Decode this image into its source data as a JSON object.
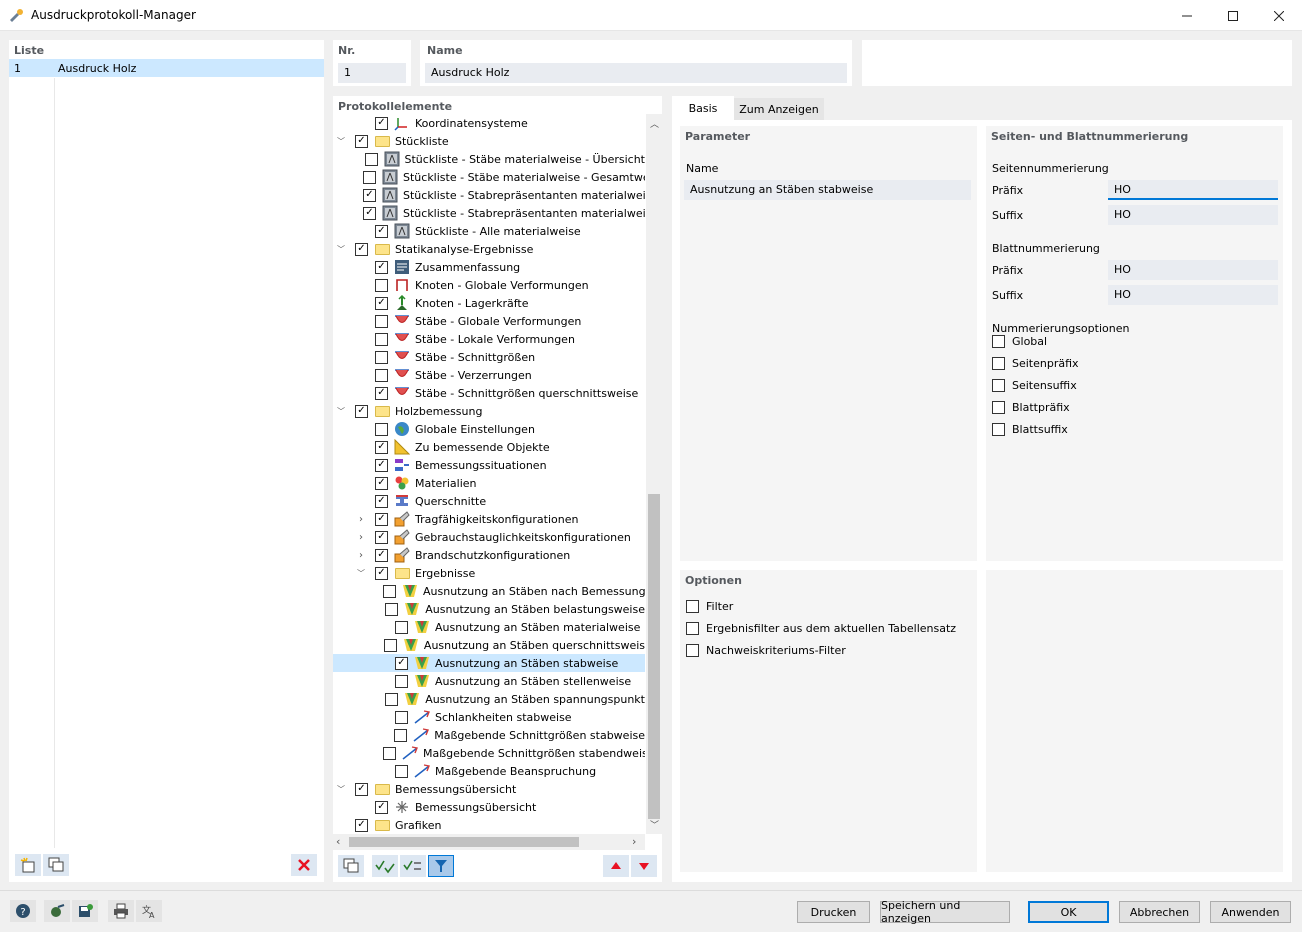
{
  "window": {
    "title": "Ausdruckprotokoll-Manager",
    "minimize": "–",
    "maximize": "☐",
    "close": "✕"
  },
  "list": {
    "header": "Liste",
    "items": [
      {
        "number": "1",
        "name": "Ausdruck Holz"
      }
    ]
  },
  "nr": {
    "header": "Nr.",
    "value": "1"
  },
  "name": {
    "header": "Name",
    "value": "Ausdruck Holz"
  },
  "tree": {
    "header": "Protokollelemente",
    "rows": [
      {
        "label": "Koordinatensysteme",
        "level": 1,
        "checked": true,
        "icon": "axes-icon"
      },
      {
        "label": "Stückliste",
        "level": 0,
        "checked": true,
        "icon": "folder-icon",
        "expand": "⌄"
      },
      {
        "label": "Stückliste - Stäbe materialweise - Übersicht",
        "level": 1,
        "checked": false,
        "icon": "table-icon"
      },
      {
        "label": "Stückliste - Stäbe materialweise - Gesamtwert",
        "level": 1,
        "checked": false,
        "icon": "table-icon"
      },
      {
        "label": "Stückliste - Stabrepräsentanten materialweis",
        "level": 1,
        "checked": true,
        "icon": "table-icon"
      },
      {
        "label": "Stückliste - Stabrepräsentanten materialweis",
        "level": 1,
        "checked": true,
        "icon": "table-icon"
      },
      {
        "label": "Stückliste - Alle materialweise",
        "level": 1,
        "checked": true,
        "icon": "table-icon"
      },
      {
        "label": "Statikanalyse-Ergebnisse",
        "level": 0,
        "checked": true,
        "icon": "folder-icon",
        "expand": "⌄"
      },
      {
        "label": "Zusammenfassung",
        "level": 1,
        "checked": true,
        "icon": "summary-icon"
      },
      {
        "label": "Knoten - Globale Verformungen",
        "level": 1,
        "checked": false,
        "icon": "node-deformation-icon"
      },
      {
        "label": "Knoten - Lagerkräfte",
        "level": 1,
        "checked": true,
        "icon": "support-force-icon"
      },
      {
        "label": "Stäbe - Globale Verformungen",
        "level": 1,
        "checked": false,
        "icon": "member-diagram-icon"
      },
      {
        "label": "Stäbe - Lokale Verformungen",
        "level": 1,
        "checked": false,
        "icon": "member-diagram-icon"
      },
      {
        "label": "Stäbe - Schnittgrößen",
        "level": 1,
        "checked": false,
        "icon": "member-diagram-icon"
      },
      {
        "label": "Stäbe - Verzerrungen",
        "level": 1,
        "checked": false,
        "icon": "member-diagram-icon"
      },
      {
        "label": "Stäbe - Schnittgrößen querschnittsweise",
        "level": 1,
        "checked": true,
        "icon": "member-diagram-icon"
      },
      {
        "label": "Holzbemessung",
        "level": 0,
        "checked": true,
        "icon": "folder-icon",
        "expand": "⌄"
      },
      {
        "label": "Globale Einstellungen",
        "level": 1,
        "checked": false,
        "icon": "globe-icon"
      },
      {
        "label": "Zu bemessende Objekte",
        "level": 1,
        "checked": true,
        "icon": "triangle-ruler-icon"
      },
      {
        "label": "Bemessungssituationen",
        "level": 1,
        "checked": true,
        "icon": "design-situation-icon"
      },
      {
        "label": "Materialien",
        "level": 1,
        "checked": true,
        "icon": "materials-icon"
      },
      {
        "label": "Querschnitte",
        "level": 1,
        "checked": true,
        "icon": "cross-section-icon"
      },
      {
        "label": "Tragfähigkeitskonfigurationen",
        "level": 1,
        "checked": true,
        "icon": "config-icon",
        "expand": "›"
      },
      {
        "label": "Gebrauchstauglichkeitskonfigurationen",
        "level": 1,
        "checked": true,
        "icon": "config-icon",
        "expand": "›"
      },
      {
        "label": "Brandschutzkonfigurationen",
        "level": 1,
        "checked": true,
        "icon": "config-icon",
        "expand": "›"
      },
      {
        "label": "Ergebnisse",
        "level": 1,
        "checked": true,
        "icon": "folder-icon",
        "expand": "⌄"
      },
      {
        "label": "Ausnutzung an Stäben nach Bemessungs",
        "level": 2,
        "checked": false,
        "icon": "utilization-icon"
      },
      {
        "label": "Ausnutzung an Stäben belastungsweise",
        "level": 2,
        "checked": false,
        "icon": "utilization-icon"
      },
      {
        "label": "Ausnutzung an Stäben materialweise",
        "level": 2,
        "checked": false,
        "icon": "utilization-icon"
      },
      {
        "label": "Ausnutzung an Stäben querschnittsweis",
        "level": 2,
        "checked": false,
        "icon": "utilization-icon"
      },
      {
        "label": "Ausnutzung an Stäben stabweise",
        "level": 2,
        "checked": true,
        "icon": "utilization-icon",
        "selected": true
      },
      {
        "label": "Ausnutzung an Stäben stellenweise",
        "level": 2,
        "checked": false,
        "icon": "utilization-icon"
      },
      {
        "label": "Ausnutzung an Stäben spannungspunkt",
        "level": 2,
        "checked": false,
        "icon": "utilization-icon"
      },
      {
        "label": "Schlankheiten stabweise",
        "level": 2,
        "checked": false,
        "icon": "slenderness-icon"
      },
      {
        "label": "Maßgebende Schnittgrößen stabweise",
        "level": 2,
        "checked": false,
        "icon": "slenderness-icon"
      },
      {
        "label": "Maßgebende Schnittgrößen stabendweis",
        "level": 2,
        "checked": false,
        "icon": "slenderness-icon"
      },
      {
        "label": "Maßgebende Beanspruchung",
        "level": 2,
        "checked": false,
        "icon": "slenderness-icon"
      },
      {
        "label": "Bemessungsübersicht",
        "level": 0,
        "checked": true,
        "icon": "folder-icon",
        "expand": "⌄"
      },
      {
        "label": "Bemessungsübersicht",
        "level": 1,
        "checked": true,
        "icon": "asterisk-icon"
      },
      {
        "label": "Grafiken",
        "level": 0,
        "checked": true,
        "icon": "folder-icon"
      }
    ]
  },
  "tabs": [
    {
      "label": "Basis",
      "active": true
    },
    {
      "label": "Zum Anzeigen",
      "active": false
    }
  ],
  "parameter": {
    "header": "Parameter",
    "name_label": "Name",
    "name_value": "Ausnutzung an Stäben stabweise"
  },
  "numbering": {
    "header": "Seiten- und Blattnummerierung",
    "page_header": "Seitennummerierung",
    "page_prefix_label": "Präfix",
    "page_prefix_value": "HO",
    "page_suffix_label": "Suffix",
    "page_suffix_value": "HO",
    "sheet_header": "Blattnummerierung",
    "sheet_prefix_label": "Präfix",
    "sheet_prefix_value": "HO",
    "sheet_suffix_label": "Suffix",
    "sheet_suffix_value": "HO",
    "options_header": "Nummerierungsoptionen",
    "options": [
      {
        "label": "Global",
        "checked": false
      },
      {
        "label": "Seitenpräfix",
        "checked": false
      },
      {
        "label": "Seitensuffix",
        "checked": false
      },
      {
        "label": "Blattpräfix",
        "checked": false
      },
      {
        "label": "Blattsuffix",
        "checked": false
      }
    ]
  },
  "optionen": {
    "header": "Optionen",
    "items": [
      {
        "label": "Filter",
        "checked": false
      },
      {
        "label": "Ergebnisfilter aus dem aktuellen Tabellensatz",
        "checked": false
      },
      {
        "label": "Nachweiskriteriums-Filter",
        "checked": false
      }
    ]
  },
  "footer": {
    "print": "Drucken",
    "save_show": "Speichern und anzeigen",
    "ok": "OK",
    "cancel": "Abbrechen",
    "apply": "Anwenden"
  },
  "colors": {
    "accent": "#0078d7",
    "selection": "#cce8ff",
    "field_bg": "#e9ecf1",
    "delete_red": "#e81123"
  }
}
